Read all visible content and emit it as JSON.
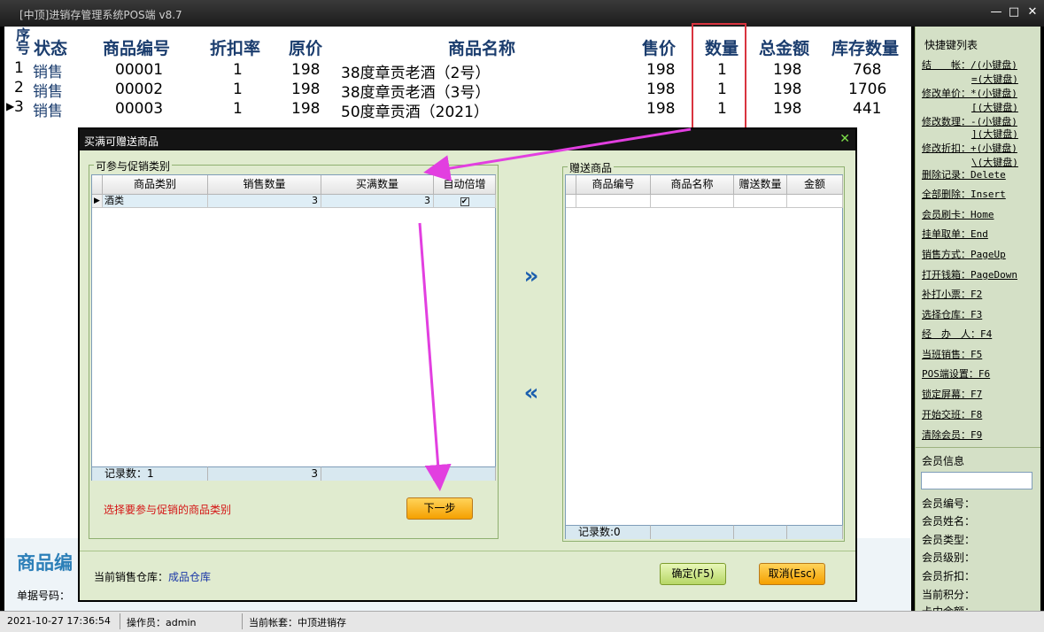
{
  "window": {
    "title": "[中顶]进销存管理系统POS端 v8.7",
    "btn_min": "—",
    "btn_max": "□",
    "btn_close": "✕"
  },
  "sales_table": {
    "headers": {
      "seq": "序号",
      "status": "状态",
      "code": "商品编号",
      "discount": "折扣率",
      "orig_price": "原价",
      "name": "商品名称",
      "price": "售价",
      "qty": "数量",
      "total": "总金额",
      "stock": "库存数量"
    },
    "rows": [
      {
        "seq": "1",
        "status": "销售",
        "code": "00001",
        "discount": "1",
        "orig_price": "198",
        "name": "38度章贡老酒（2号）",
        "price": "198",
        "qty": "1",
        "total": "198",
        "stock": "768"
      },
      {
        "seq": "2",
        "status": "销售",
        "code": "00002",
        "discount": "1",
        "orig_price": "198",
        "name": "38度章贡老酒（3号）",
        "price": "198",
        "qty": "1",
        "total": "198",
        "stock": "1706"
      },
      {
        "seq": "3",
        "status": "销售",
        "code": "00003",
        "discount": "1",
        "orig_price": "198",
        "name": "50度章贡酒（2021）",
        "price": "198",
        "qty": "1",
        "total": "198",
        "stock": "441"
      }
    ],
    "current_row_marker": "▶"
  },
  "under_panel": {
    "big_label": "商品编",
    "doc_label": "单据号码："
  },
  "dialog": {
    "title": "买满可赠送商品",
    "close": "✕",
    "left_group": {
      "label": "可参与促销类别",
      "columns": [
        "商品类别",
        "销售数量",
        "买满数量",
        "自动倍增"
      ],
      "rows": [
        {
          "category": "酒类",
          "sales_qty": "3",
          "full_qty": "3",
          "auto": "✔"
        }
      ],
      "footer_label": "记录数：1",
      "footer_sum": "3"
    },
    "right_group": {
      "label": "赠送商品",
      "columns": [
        "商品编号",
        "商品名称",
        "赠送数量",
        "金额"
      ],
      "footer_label": "记录数:0"
    },
    "move_right": "»",
    "move_left": "«",
    "hint": "选择要参与促销的商品类别",
    "next_button": "下一步",
    "warehouse_label": "当前销售仓库：",
    "warehouse_value": "成品仓库",
    "ok_button": "确定(F5)",
    "cancel_button": "取消(Esc)"
  },
  "shortcuts": {
    "title": "快捷键列表",
    "items": [
      "结　　帐：/(小键盘)",
      "=(大键盘)",
      "修改单价：*(小键盘)",
      "[(大键盘)",
      "修改数理：-(小键盘)",
      "](大键盘)",
      "修改折扣：+(小键盘)",
      "\\(大键盘)",
      "删除记录：Delete",
      "全部删除：Insert",
      "会员刷卡：Home",
      "挂单取单：End",
      "销售方式：PageUp",
      "打开钱箱：PageDown",
      "补打小票：F2",
      "选择仓库：F3",
      "经　办　人：F4",
      "当班销售：F5",
      "POS端设置：F6",
      "锁定屏幕：F7",
      "开始交班：F8",
      "清除会员：F9"
    ]
  },
  "member": {
    "title": "会员信息",
    "fields": [
      "会员编号：",
      "会员姓名：",
      "会员类型：",
      "会员级别：",
      "会员折扣：",
      "当前积分：",
      "卡内余额："
    ]
  },
  "statusbar": {
    "datetime": "2021-10-27 17:36:54",
    "operator": "操作员：admin",
    "account": "当前帐套：中顶进销存"
  },
  "colors": {
    "header_text": "#1b3d6e",
    "highlight_box": "#d9343f",
    "annotation_arrow": "#e23fe0",
    "sidebar_bg": "#d4e0c6",
    "dialog_bg": "#e0ebcf"
  }
}
